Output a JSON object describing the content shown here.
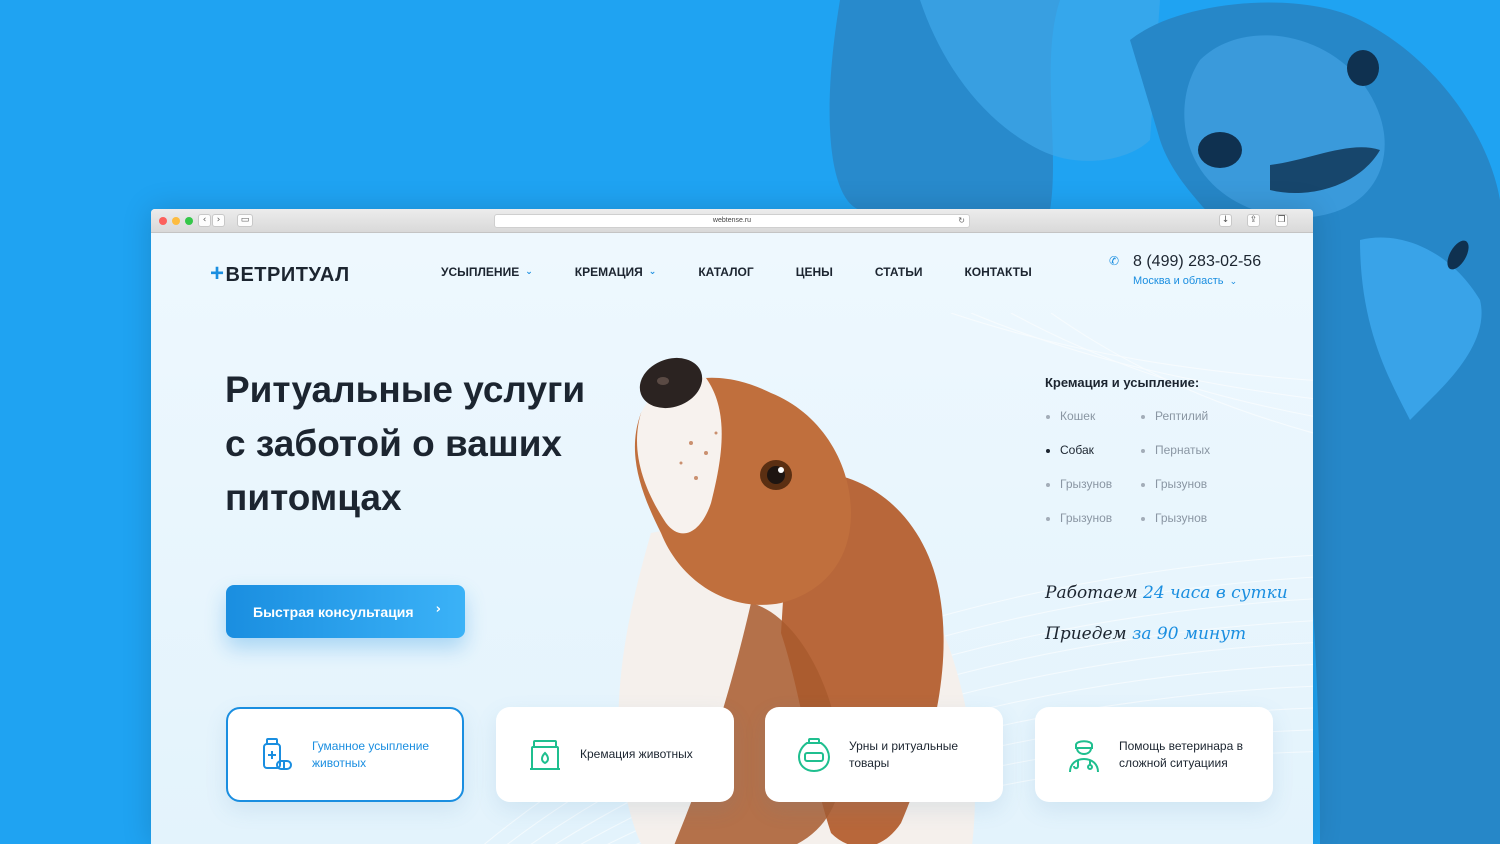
{
  "browser": {
    "url": "webtense.ru"
  },
  "header": {
    "logo": "ВЕТРИТУАЛ",
    "menu": [
      {
        "label": "УСЫПЛЕНИЕ",
        "dropdown": true
      },
      {
        "label": "КРЕМАЦИЯ",
        "dropdown": true
      },
      {
        "label": "КАТАЛОГ",
        "dropdown": false
      },
      {
        "label": "ЦЕНЫ",
        "dropdown": false
      },
      {
        "label": "СТАТЬИ",
        "dropdown": false
      },
      {
        "label": "КОНТАКТЫ",
        "dropdown": false
      }
    ],
    "phone": "8 (499) 283-02-56",
    "region": "Москва и область"
  },
  "hero": {
    "title_lines": [
      "Ритуальные услуги",
      "с заботой о ваших",
      "питомцах"
    ],
    "cta_label": "Быстрая консультация"
  },
  "services": {
    "title": "Кремация и усыпление:",
    "items": [
      {
        "label": "Кошек",
        "active": false
      },
      {
        "label": "Рептилий",
        "active": false
      },
      {
        "label": "Собак",
        "active": true
      },
      {
        "label": "Пернатых",
        "active": false
      },
      {
        "label": "Грызунов",
        "active": false
      },
      {
        "label": "Грызунов",
        "active": false
      },
      {
        "label": "Грызунов",
        "active": false
      },
      {
        "label": "Грызунов",
        "active": false
      }
    ]
  },
  "promo": {
    "line1_prefix": "Работаем",
    "line1_highlight": "24 часа в сутки",
    "line2_prefix": "Приедем",
    "line2_highlight": "за 90 минут"
  },
  "cards": [
    {
      "label_lines": [
        "Гуманное усыпление",
        "животных"
      ],
      "icon": "medicine-icon",
      "active": true
    },
    {
      "label_lines": [
        "Кремация животных"
      ],
      "icon": "crematorium-icon",
      "active": false
    },
    {
      "label_lines": [
        "Урны и ритуальные",
        "товары"
      ],
      "icon": "urn-icon",
      "active": false
    },
    {
      "label_lines": [
        "Помощь ветеринара в",
        "сложной ситуациия"
      ],
      "icon": "veterinarian-icon",
      "active": false
    }
  ],
  "colors": {
    "accent": "#1a8ee0",
    "background": "#1fa3f2",
    "icon_green": "#1fbf8f",
    "text": "#1c2530"
  }
}
